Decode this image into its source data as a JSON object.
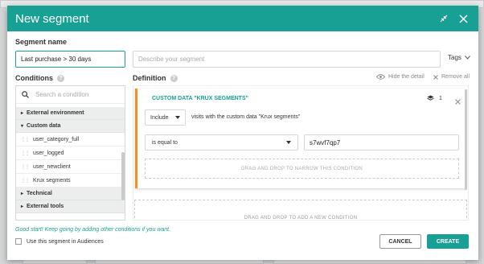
{
  "modal": {
    "title": "New segment"
  },
  "segment_name": {
    "label": "Segment name",
    "value": "Last purchase > 30 days",
    "description_placeholder": "Describe your segment",
    "tags_label": "Tags"
  },
  "conditions": {
    "label": "Conditions",
    "search_placeholder": "Search a condition",
    "categories": [
      {
        "label": "External environment",
        "expanded": false
      },
      {
        "label": "Custom data",
        "expanded": true
      },
      {
        "label": "Technical",
        "expanded": false
      },
      {
        "label": "External tools",
        "expanded": false
      }
    ],
    "custom_data_items": [
      "user_category_full",
      "user_logged",
      "user_newclient",
      "Krux segments"
    ]
  },
  "definition": {
    "label": "Definition",
    "hide_detail": "Hide the detail",
    "remove_all": "Remove all",
    "card": {
      "title": "CUSTOM DATA \"KRUX SEGMENTS\"",
      "count": "1",
      "include_value": "Include",
      "visits_text": "visits with the custom data \"Krux segments\"",
      "operator_value": "is equal to",
      "input_value": "s7wvf7qp7",
      "narrow_hint": "DRAG AND DROP TO NARROW THIS CONDITION"
    },
    "add_hint": "DRAG AND DROP TO ADD A NEW CONDITION"
  },
  "footer": {
    "hint": "Good start! Keep going by adding other conditions if you want.",
    "audience_label": "Use this segment in Audiences",
    "cancel_label": "CANCEL",
    "create_label": "CREATE"
  },
  "colors": {
    "accent": "#17a093",
    "condition_border": "#f29223"
  }
}
